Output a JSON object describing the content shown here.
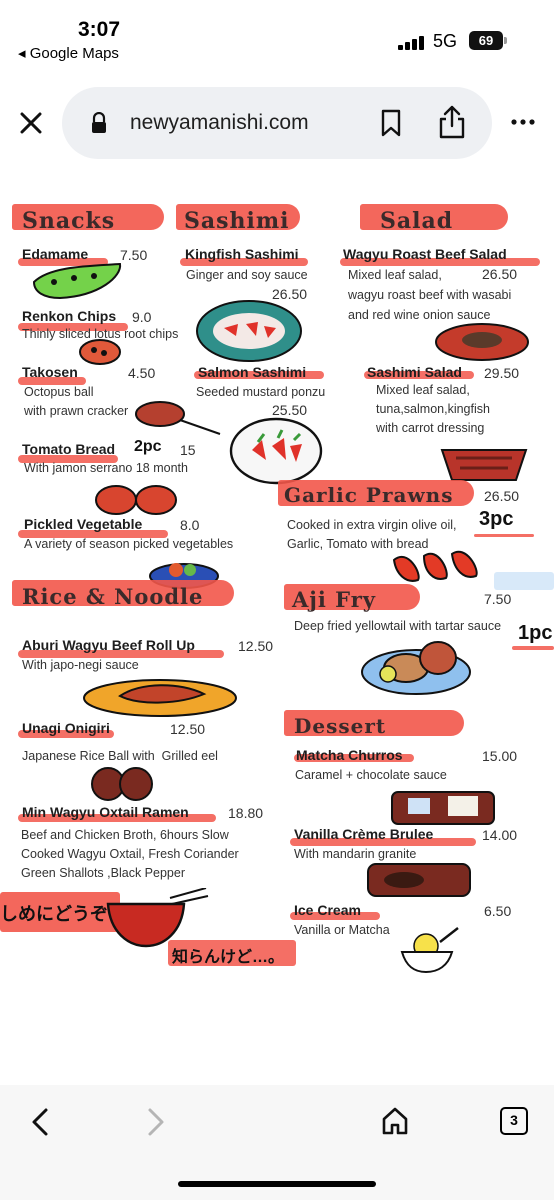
{
  "status": {
    "time": "3:07",
    "back_app": "◂ Google Maps",
    "network": "5G",
    "battery": "69"
  },
  "browser": {
    "url": "newyamanishi.com",
    "tab_count": "3"
  },
  "menu": {
    "snacks": {
      "title": "Snacks",
      "items": [
        {
          "name": "Edamame",
          "price": "7.50",
          "desc": ""
        },
        {
          "name": "Renkon Chips",
          "price": "9.0",
          "desc": "Thinly sliced lotus root chips"
        },
        {
          "name": "Takosen",
          "price": "4.50",
          "desc": "Octopus ball\nwith prawn cracker"
        },
        {
          "name": "Tomato Bread",
          "note": "2pc",
          "price": "15",
          "desc": "With jamon serrano 18 month"
        },
        {
          "name": "Pickled Vegetable",
          "price": "8.0",
          "desc": "A variety of season picked vegetables"
        }
      ]
    },
    "sashimi": {
      "title": "Sashimi",
      "items": [
        {
          "name": "Kingfish Sashimi",
          "price": "26.50",
          "desc": "Ginger and soy sauce"
        },
        {
          "name": "Salmon Sashimi",
          "price": "25.50",
          "desc": "Seeded mustard ponzu"
        }
      ]
    },
    "salad": {
      "title": "Salad",
      "items": [
        {
          "name": "Wagyu Roast Beef Salad",
          "price": "26.50",
          "desc": "Mixed leaf salad,\nwagyu roast beef with wasabi\nand red wine onion sauce"
        },
        {
          "name": "Sashimi Salad",
          "price": "29.50",
          "desc": "Mixed leaf salad,\ntuna,salmon,kingfish\nwith carrot dressing"
        }
      ]
    },
    "garlic_prawns": {
      "title": "Garlic Prawns",
      "price": "26.50",
      "desc": "Cooked in extra virgin olive oil,\nGarlic, Tomato with bread",
      "note": "3pc"
    },
    "aji_fry": {
      "title": "Aji Fry",
      "price": "7.50",
      "desc": "Deep fried yellowtail with tartar sauce",
      "note": "1pc"
    },
    "rice_noodle": {
      "title": "Rice & Noodle",
      "items": [
        {
          "name": "Aburi Wagyu Beef Roll Up",
          "price": "12.50",
          "desc": "With japo-negi sauce"
        },
        {
          "name": "Unagi Onigiri",
          "price": "12.50",
          "desc": "Japanese Rice Ball with  Grilled eel"
        },
        {
          "name": "Min Wagyu Oxtail  Ramen",
          "price": "18.80",
          "desc": "Beef and Chicken Broth, 6hours Slow\nCooked Wagyu Oxtail, Fresh Coriander\nGreen Shallots ,Black Pepper"
        }
      ],
      "jp_note_1": "しめにどうぞ",
      "jp_note_2": "知らんけど…。"
    },
    "dessert": {
      "title": "Dessert",
      "items": [
        {
          "name": "Matcha Churros",
          "price": "15.00",
          "desc": "Caramel + chocolate sauce"
        },
        {
          "name": "Vanilla Crème Brulee",
          "price": "14.00",
          "desc": "With mandarin granite"
        },
        {
          "name": "Ice Cream",
          "price": "6.50",
          "desc": "Vanilla or Matcha"
        }
      ]
    }
  },
  "colors": {
    "accent": "#f2564a",
    "urlbar": "#eef0f3"
  },
  "icons": [
    "signal-icon",
    "lock-icon",
    "close-icon",
    "bookmark-icon",
    "share-icon",
    "more-icon",
    "back-icon",
    "forward-icon",
    "home-icon",
    "tabs-icon"
  ]
}
